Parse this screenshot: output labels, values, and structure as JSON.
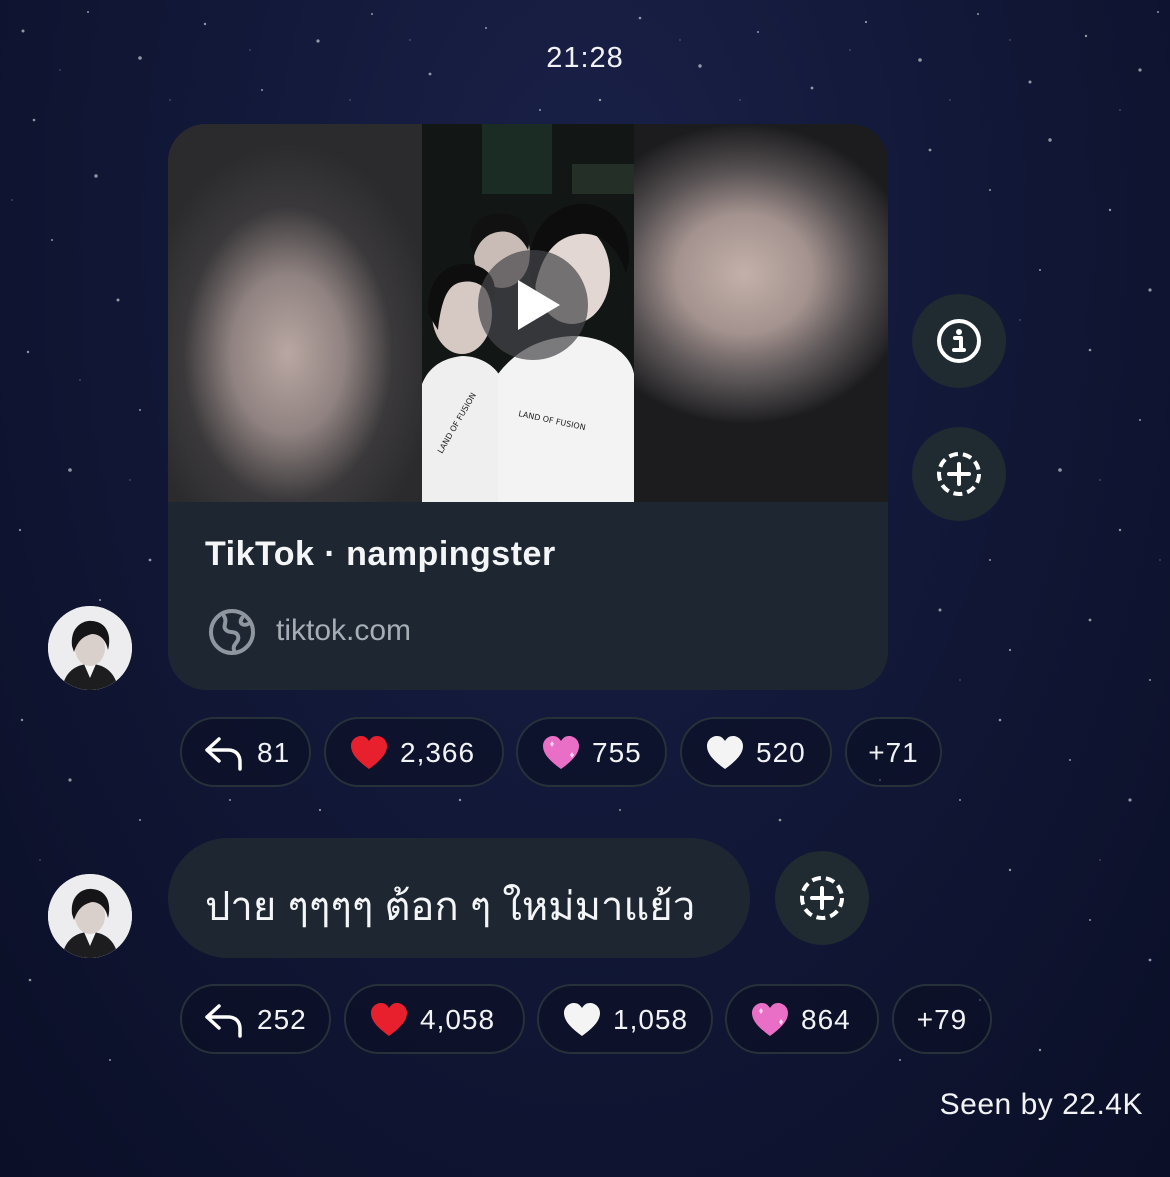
{
  "timestamp": "21:28",
  "link_card": {
    "title": "TikTok · nampingster",
    "domain": "tiktok.com"
  },
  "side_buttons": {
    "info_icon": "info-icon",
    "add_reaction_icon": "add-reaction-icon"
  },
  "post_reactions": [
    {
      "icon": "reply-arrow-icon",
      "count": "81"
    },
    {
      "icon": "red-heart-icon",
      "count": "2,366"
    },
    {
      "icon": "pink-heart-icon",
      "count": "755"
    },
    {
      "icon": "white-heart-icon",
      "count": "520"
    },
    {
      "icon": "",
      "count": "+71"
    }
  ],
  "message": {
    "text": "ปาย ๆๆๆๆ ต้อก ๆ ใหม่มาแย้ว"
  },
  "message_reactions": [
    {
      "icon": "reply-arrow-icon",
      "count": "252"
    },
    {
      "icon": "red-heart-icon",
      "count": "4,058"
    },
    {
      "icon": "white-heart-icon",
      "count": "1,058"
    },
    {
      "icon": "pink-heart-icon",
      "count": "864"
    },
    {
      "icon": "",
      "count": "+79"
    }
  ],
  "seen_by": "Seen by 22.4K",
  "colors": {
    "background": "#0f1533",
    "bubble": "#1e2731",
    "pill_border": "#26313a",
    "red_heart": "#e8202e",
    "pink_heart": "#e86fc5",
    "white_heart": "#f4f4f4"
  }
}
